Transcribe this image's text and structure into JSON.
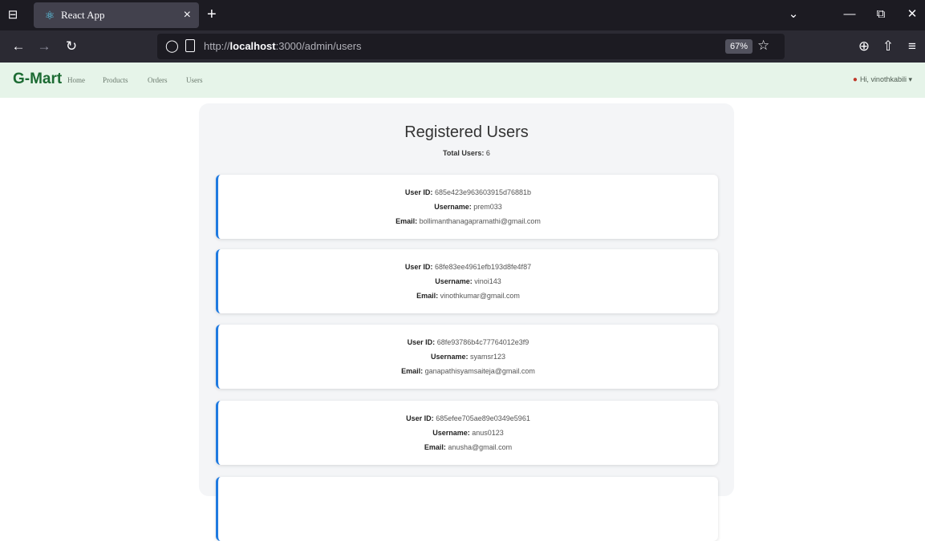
{
  "browser": {
    "tab_title": "React App",
    "url_prefix": "http://",
    "url_host": "localhost",
    "url_path": ":3000/admin/users",
    "zoom": "67%"
  },
  "app": {
    "brand": "G-Mart",
    "nav": [
      "Home",
      "Products",
      "Orders",
      "Users"
    ],
    "user_greeting": "Hi, vinothkabili"
  },
  "page": {
    "title": "Registered Users",
    "total_label": "Total Users:",
    "total_value": "6"
  },
  "labels": {
    "user_id": "User ID:",
    "username": "Username:",
    "email": "Email:"
  },
  "users": [
    {
      "id": "685e423e963603915d76881b",
      "username": "prem033",
      "email": "bollimanthanagapramathi@gmail.com"
    },
    {
      "id": "68fe83ee4961efb193d8fe4f87",
      "username": "vinoi143",
      "email": "vinothkumar@gmail.com"
    },
    {
      "id": "68fe93786b4c77764012e3f9",
      "username": "syamsr123",
      "email": "ganapathisyamsaiteja@gmail.com"
    },
    {
      "id": "685efee705ae89e0349e5961",
      "username": "anus0123",
      "email": "anusha@gmail.com"
    }
  ],
  "colors": {
    "accent": "#1f7ae0",
    "brand": "#1c6b33",
    "appbar_bg": "#e6f4e9"
  },
  "icons": {
    "favicon": "react-icon",
    "user": "user-icon"
  }
}
